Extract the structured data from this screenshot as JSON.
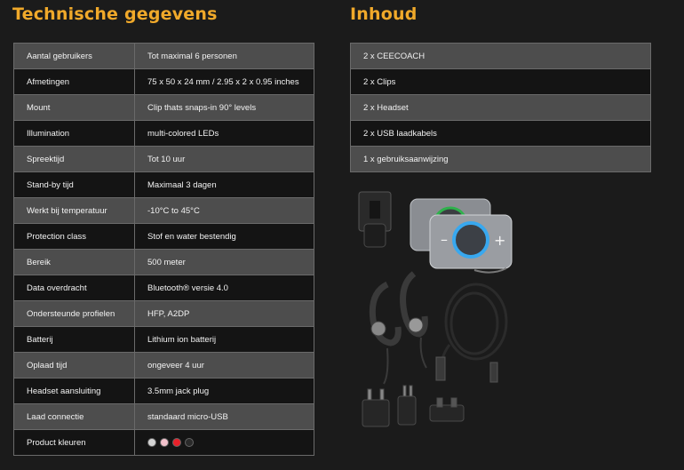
{
  "specs": {
    "title": "Technische gegevens",
    "rows": [
      {
        "label": "Aantal gebruikers",
        "value": "Tot maximal 6 personen"
      },
      {
        "label": "Afmetingen",
        "value": "75 x 50 x 24 mm / 2.95 x 2 x 0.95 inches"
      },
      {
        "label": "Mount",
        "value": "Clip thats snaps-in 90° levels"
      },
      {
        "label": "Illumination",
        "value": "multi-colored LEDs"
      },
      {
        "label": "Spreektijd",
        "value": "Tot 10 uur"
      },
      {
        "label": "Stand-by tijd",
        "value": "Maximaal 3 dagen"
      },
      {
        "label": "Werkt bij temperatuur",
        "value": "-10°C to 45°C"
      },
      {
        "label": "Protection class",
        "value": "Stof en water bestendig"
      },
      {
        "label": "Bereik",
        "value": "500 meter"
      },
      {
        "label": "Data overdracht",
        "value": "Bluetooth® versie 4.0"
      },
      {
        "label": "Ondersteunde profielen",
        "value": "HFP, A2DP"
      },
      {
        "label": "Batterij",
        "value": "Lithium ion batterij"
      },
      {
        "label": "Oplaad tijd",
        "value": "ongeveer 4 uur"
      },
      {
        "label": "Headset aansluiting",
        "value": "3.5mm jack plug"
      },
      {
        "label": "Laad connectie",
        "value": "standaard micro-USB"
      },
      {
        "label": "Product kleuren",
        "value": ""
      }
    ],
    "colors": [
      "#d4d4d4",
      "#f2c2cc",
      "#e8212a",
      "#2a2a2a"
    ]
  },
  "contents": {
    "title": "Inhoud",
    "items": [
      "2 x CEECOACH",
      "2 x Clips",
      "2 x Headset",
      "2 x USB laadkabels",
      "1 x gebruiksaanwijzing"
    ]
  },
  "icons": [
    "product-photo"
  ]
}
